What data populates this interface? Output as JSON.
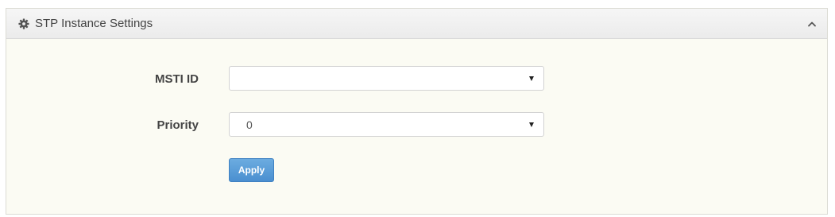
{
  "panel": {
    "title": "STP Instance Settings",
    "header_icon": "gear-icon",
    "collapse_icon": "chevron-up-icon"
  },
  "form": {
    "msti_id": {
      "label": "MSTI ID",
      "value": ""
    },
    "priority": {
      "label": "Priority",
      "value": "0"
    }
  },
  "actions": {
    "apply_label": "Apply"
  },
  "colors": {
    "panel_background": "#fbfbf3",
    "header_background": "#ebebeb",
    "apply_button": "#4a8fd0"
  }
}
